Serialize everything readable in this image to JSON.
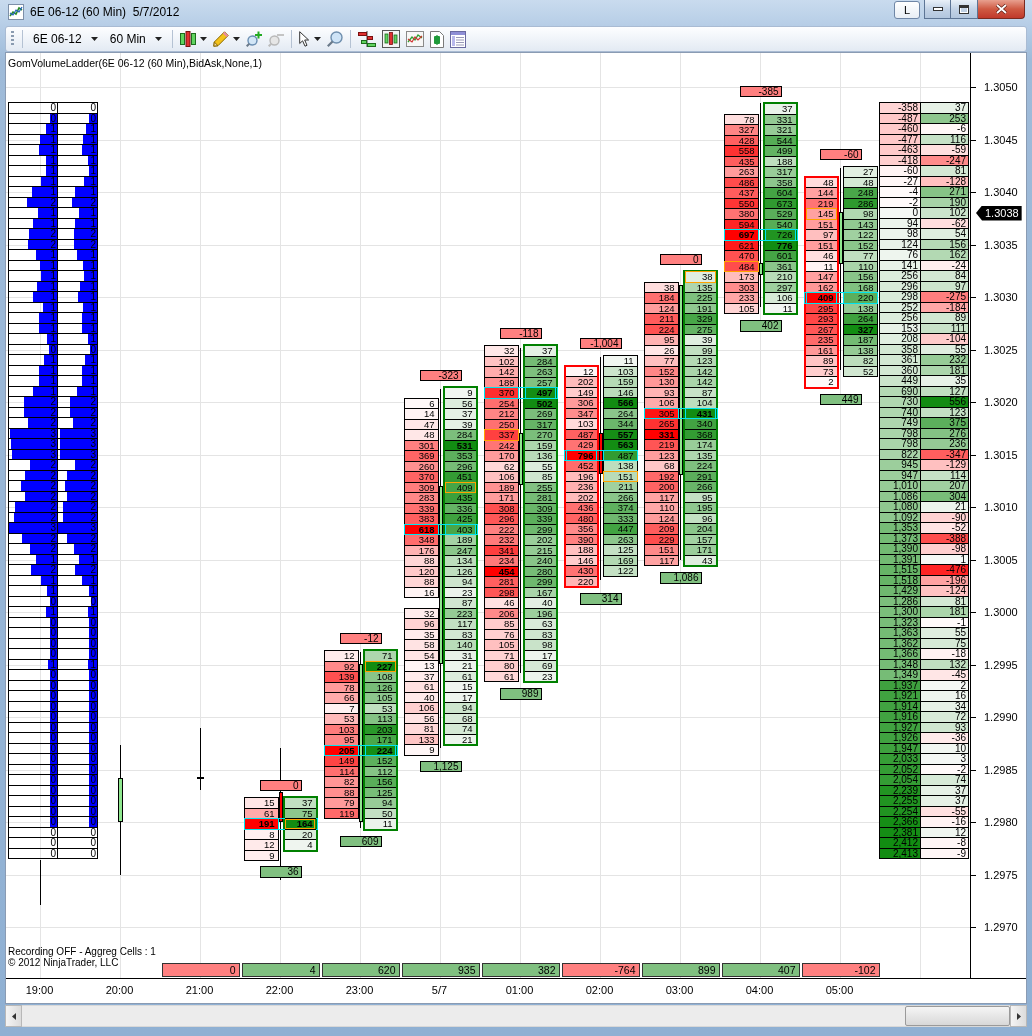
{
  "window": {
    "title": "6E 06-12 (60 Min)  5/7/2012",
    "title_button": "L"
  },
  "toolbar": {
    "instrument": "6E 06-12",
    "period": "60 Min",
    "zoom_out_disabled": true
  },
  "indicator_label": "GomVolumeLadder(6E 06-12 (60 Min),BidAsk,None,1)",
  "ladder": {
    "columns": [
      {
        "cells": [
          {
            "value": "0"
          },
          {
            "value": "0",
            "level": 0.15
          },
          {
            "value": "1",
            "level": 0.23
          },
          {
            "value": "1",
            "level": 0.35
          },
          {
            "value": "1",
            "level": 0.37
          },
          {
            "value": "1",
            "level": 0.23
          },
          {
            "value": "1",
            "level": 0.22
          },
          {
            "value": "1",
            "level": 0.33
          },
          {
            "value": "1",
            "level": 0.53
          },
          {
            "value": "2",
            "level": 0.63
          },
          {
            "value": "1",
            "level": 0.4
          },
          {
            "value": "1",
            "level": 0.51
          },
          {
            "value": "2",
            "level": 0.59
          },
          {
            "value": "2",
            "level": 0.6
          },
          {
            "value": "1",
            "level": 0.43
          },
          {
            "value": "1",
            "level": 0.35
          },
          {
            "value": "1",
            "level": 0.33
          },
          {
            "value": "1",
            "level": 0.41
          },
          {
            "value": "1",
            "level": 0.49
          },
          {
            "value": "1",
            "level": 0.3
          },
          {
            "value": "1",
            "level": 0.37
          },
          {
            "value": "1",
            "level": 0.37
          },
          {
            "value": "1",
            "level": 0.2
          },
          {
            "value": "0",
            "level": 0.17
          },
          {
            "value": "1",
            "level": 0.27
          },
          {
            "value": "1",
            "level": 0.37
          },
          {
            "value": "1",
            "level": 0.38
          },
          {
            "value": "1",
            "level": 0.49
          },
          {
            "value": "2",
            "level": 0.69
          },
          {
            "value": "2",
            "level": 0.69
          },
          {
            "value": "2",
            "level": 0.6
          },
          {
            "value": "3",
            "level": 0.97
          },
          {
            "value": "3",
            "level": 0.95
          },
          {
            "value": "3",
            "level": 0.93
          },
          {
            "value": "2",
            "level": 0.57
          },
          {
            "value": "2",
            "level": 0.67
          },
          {
            "value": "2",
            "level": 0.75
          },
          {
            "value": "2",
            "level": 0.67
          },
          {
            "value": "2",
            "level": 0.87
          },
          {
            "value": "2",
            "level": 0.89
          },
          {
            "value": "3",
            "level": 1
          },
          {
            "value": "2",
            "level": 0.73
          },
          {
            "value": "2",
            "level": 0.57
          },
          {
            "value": "1",
            "level": 0.43
          },
          {
            "value": "2",
            "level": 0.55
          },
          {
            "value": "1",
            "level": 0.33
          },
          {
            "value": "1",
            "level": 0.2
          },
          {
            "value": "0",
            "level": 0.15
          },
          {
            "value": "1",
            "level": 0.23
          },
          {
            "value": "0",
            "level": 0.15
          },
          {
            "value": "0",
            "level": 0.15
          },
          {
            "value": "0",
            "level": 0.15
          },
          {
            "value": "0",
            "level": 0.15
          },
          {
            "value": "1",
            "level": 0.19
          },
          {
            "value": "0",
            "level": 0.15
          },
          {
            "value": "0",
            "level": 0.15
          },
          {
            "value": "0",
            "level": 0.15
          },
          {
            "value": "0",
            "level": 0.15
          },
          {
            "value": "0",
            "level": 0.15
          },
          {
            "value": "0",
            "level": 0.15
          },
          {
            "value": "0",
            "level": 0.15
          },
          {
            "value": "0",
            "level": 0.15
          },
          {
            "value": "0",
            "level": 0.15
          },
          {
            "value": "0",
            "level": 0.15
          },
          {
            "value": "0",
            "level": 0.15
          },
          {
            "value": "0",
            "level": 0.15
          },
          {
            "value": "0",
            "level": 0.15
          },
          {
            "value": "0",
            "level": 0.15
          },
          {
            "value": "0",
            "level": 0.15
          },
          {
            "value": "0"
          },
          {
            "value": "0"
          },
          {
            "value": "0"
          }
        ]
      },
      {
        "cells": [
          {
            "value": "0"
          },
          {
            "value": "0",
            "level": 0.2
          },
          {
            "value": "1",
            "level": 0.27
          },
          {
            "value": "1",
            "level": 0.37
          },
          {
            "value": "1",
            "level": 0.39
          },
          {
            "value": "1",
            "level": 0.23
          },
          {
            "value": "1",
            "level": 0.21
          },
          {
            "value": "1",
            "level": 0.33
          },
          {
            "value": "1",
            "level": 0.57
          },
          {
            "value": "2",
            "level": 0.63
          },
          {
            "value": "1",
            "level": 0.45
          },
          {
            "value": "1",
            "level": 0.57
          },
          {
            "value": "2",
            "level": 0.6
          },
          {
            "value": "2",
            "level": 0.6
          },
          {
            "value": "1",
            "level": 0.51
          },
          {
            "value": "1",
            "level": 0.37
          },
          {
            "value": "1",
            "level": 0.33
          },
          {
            "value": "1",
            "level": 0.43
          },
          {
            "value": "1",
            "level": 0.49
          },
          {
            "value": "1",
            "level": 0.35
          },
          {
            "value": "1",
            "level": 0.39
          },
          {
            "value": "1",
            "level": 0.39
          },
          {
            "value": "1",
            "level": 0.23
          },
          {
            "value": "0",
            "level": 0.18
          },
          {
            "value": "1",
            "level": 0.3
          },
          {
            "value": "1",
            "level": 0.39
          },
          {
            "value": "1",
            "level": 0.39
          },
          {
            "value": "1",
            "level": 0.51
          },
          {
            "value": "2",
            "level": 0.7
          },
          {
            "value": "2",
            "level": 0.7
          },
          {
            "value": "2",
            "level": 0.61
          },
          {
            "value": "3",
            "level": 0.96
          },
          {
            "value": "3",
            "level": 0.94
          },
          {
            "value": "3",
            "level": 0.94
          },
          {
            "value": "2",
            "level": 0.57
          },
          {
            "value": "2",
            "level": 0.76
          },
          {
            "value": "2",
            "level": 0.82
          },
          {
            "value": "2",
            "level": 0.76
          },
          {
            "value": "2",
            "level": 0.88
          },
          {
            "value": "2",
            "level": 0.88
          },
          {
            "value": "3",
            "level": 1
          },
          {
            "value": "2",
            "level": 0.76
          },
          {
            "value": "2",
            "level": 0.6
          },
          {
            "value": "1",
            "level": 0.45
          },
          {
            "value": "2",
            "level": 0.57
          },
          {
            "value": "1",
            "level": 0.39
          },
          {
            "value": "1",
            "level": 0.21
          },
          {
            "value": "0",
            "level": 0.15
          },
          {
            "value": "1",
            "level": 0.23
          },
          {
            "value": "0",
            "level": 0.2
          },
          {
            "value": "0",
            "level": 0.2
          },
          {
            "value": "0",
            "level": 0.2
          },
          {
            "value": "0",
            "level": 0.2
          },
          {
            "value": "1",
            "level": 0.23
          },
          {
            "value": "0",
            "level": 0.2
          },
          {
            "value": "0",
            "level": 0.2
          },
          {
            "value": "0",
            "level": 0.2
          },
          {
            "value": "0",
            "level": 0.2
          },
          {
            "value": "0",
            "level": 0.2
          },
          {
            "value": "0",
            "level": 0.2
          },
          {
            "value": "0",
            "level": 0.2
          },
          {
            "value": "0",
            "level": 0.2
          },
          {
            "value": "0",
            "level": 0.2
          },
          {
            "value": "0",
            "level": 0.2
          },
          {
            "value": "0",
            "level": 0.2
          },
          {
            "value": "0",
            "level": 0.2
          },
          {
            "value": "0",
            "level": 0.2
          },
          {
            "value": "0",
            "level": 0.2
          },
          {
            "value": "0",
            "level": 0.2
          },
          {
            "value": "0"
          },
          {
            "value": "0"
          },
          {
            "value": "0"
          }
        ]
      }
    ]
  },
  "candles": [
    {
      "kind": "wick_only"
    },
    {
      "kind": "up"
    },
    {
      "kind": "doji"
    },
    {
      "kind": "down"
    },
    {
      "kind": "up"
    },
    {
      "kind": "up"
    },
    {
      "kind": "up"
    },
    {
      "kind": "down"
    },
    {
      "kind": "up"
    },
    {
      "kind": "up"
    },
    {
      "kind": "up"
    }
  ],
  "bars": [
    {
      "top_label": "0",
      "bottom_label": "36",
      "bid_framed": false,
      "ask_framed": true,
      "rows": [
        {
          "bid": "15",
          "ask": "37",
          "highlighted": false,
          "kind": "plain"
        },
        {
          "bid": "61",
          "ask": "75",
          "highlighted": false,
          "kind": "plain"
        },
        {
          "bid": "191",
          "ask": "164",
          "highlighted": true,
          "kind": "ask_marked"
        },
        {
          "bid": "8",
          "ask": "20",
          "highlighted": false,
          "kind": "plain"
        },
        {
          "bid": "12",
          "ask": "4",
          "highlighted": false,
          "kind": "plain"
        },
        {
          "bid": "9",
          "highlighted": false,
          "kind": "plain"
        }
      ]
    },
    {
      "top_label": "-12",
      "bottom_label": "609",
      "bid_framed": false,
      "ask_framed": true,
      "rows": [
        {
          "bid": "12",
          "ask": "71",
          "highlighted": false,
          "kind": "plain"
        },
        {
          "bid": "92",
          "ask": "227",
          "highlighted": false,
          "kind": "ask_marked"
        },
        {
          "bid": "139",
          "ask": "108",
          "highlighted": false,
          "kind": "plain"
        },
        {
          "bid": "78",
          "ask": "126",
          "highlighted": false,
          "kind": "plain"
        },
        {
          "bid": "66",
          "ask": "105",
          "highlighted": false,
          "kind": "plain"
        },
        {
          "bid": "7",
          "ask": "53",
          "highlighted": false,
          "kind": "plain"
        },
        {
          "bid": "53",
          "ask": "113",
          "highlighted": false,
          "kind": "plain"
        },
        {
          "bid": "103",
          "ask": "203",
          "highlighted": false,
          "kind": "plain"
        },
        {
          "bid": "95",
          "ask": "171",
          "highlighted": false,
          "kind": "plain"
        },
        {
          "bid": "205",
          "ask": "224",
          "highlighted": true,
          "kind": "plain"
        },
        {
          "bid": "149",
          "ask": "152",
          "highlighted": false,
          "kind": "plain"
        },
        {
          "bid": "114",
          "ask": "112",
          "highlighted": false,
          "kind": "plain"
        },
        {
          "bid": "82",
          "ask": "156",
          "highlighted": false,
          "kind": "plain"
        },
        {
          "bid": "88",
          "ask": "125",
          "highlighted": false,
          "kind": "plain"
        },
        {
          "bid": "79",
          "ask": "94",
          "highlighted": false,
          "kind": "plain"
        },
        {
          "bid": "119",
          "ask": "50",
          "highlighted": false,
          "kind": "plain"
        },
        {
          "ask": "11",
          "highlighted": false,
          "kind": "plain"
        }
      ]
    },
    {
      "top_label": "-323",
      "bottom_label": "1,125",
      "bid_framed": false,
      "ask_framed": true,
      "rows": [
        {
          "ask": "9",
          "highlighted": false,
          "kind": "plain"
        },
        {
          "bid": "6",
          "ask": "56",
          "highlighted": false,
          "kind": "plain"
        },
        {
          "bid": "14",
          "ask": "37",
          "highlighted": false,
          "kind": "plain"
        },
        {
          "bid": "47",
          "ask": "39",
          "highlighted": false,
          "kind": "plain"
        },
        {
          "bid": "48",
          "ask": "284",
          "highlighted": false,
          "kind": "plain"
        },
        {
          "bid": "301",
          "ask": "531",
          "highlighted": false,
          "kind": "plain"
        },
        {
          "bid": "369",
          "ask": "353",
          "highlighted": false,
          "kind": "plain"
        },
        {
          "bid": "260",
          "ask": "296",
          "highlighted": false,
          "kind": "plain"
        },
        {
          "bid": "370",
          "ask": "451",
          "highlighted": false,
          "kind": "plain"
        },
        {
          "bid": "309",
          "ask": "409",
          "highlighted": false,
          "kind": "ask_marked"
        },
        {
          "bid": "283",
          "ask": "435",
          "highlighted": false,
          "kind": "plain"
        },
        {
          "bid": "339",
          "ask": "336",
          "highlighted": false,
          "kind": "plain"
        },
        {
          "bid": "383",
          "ask": "425",
          "highlighted": false,
          "kind": "plain"
        },
        {
          "bid": "618",
          "ask": "403",
          "highlighted": true,
          "kind": "plain"
        },
        {
          "bid": "348",
          "ask": "189",
          "highlighted": false,
          "kind": "plain"
        },
        {
          "bid": "176",
          "ask": "247",
          "highlighted": false,
          "kind": "plain"
        },
        {
          "bid": "88",
          "ask": "134",
          "highlighted": false,
          "kind": "plain"
        },
        {
          "bid": "120",
          "ask": "126",
          "highlighted": false,
          "kind": "plain"
        },
        {
          "bid": "88",
          "ask": "94",
          "highlighted": false,
          "kind": "plain"
        },
        {
          "bid": "16",
          "ask": "23",
          "highlighted": false,
          "kind": "plain"
        },
        {
          "ask": "87",
          "highlighted": false,
          "kind": "plain"
        },
        {
          "bid": "32",
          "ask": "223",
          "highlighted": false,
          "kind": "plain"
        },
        {
          "bid": "96",
          "ask": "117",
          "highlighted": false,
          "kind": "plain"
        },
        {
          "bid": "35",
          "ask": "83",
          "highlighted": false,
          "kind": "plain"
        },
        {
          "bid": "58",
          "ask": "140",
          "highlighted": false,
          "kind": "plain"
        },
        {
          "bid": "54",
          "ask": "31",
          "highlighted": false,
          "kind": "plain"
        },
        {
          "bid": "13",
          "ask": "21",
          "highlighted": false,
          "kind": "plain"
        },
        {
          "bid": "37",
          "ask": "61",
          "highlighted": false,
          "kind": "plain"
        },
        {
          "bid": "61",
          "ask": "15",
          "highlighted": false,
          "kind": "plain"
        },
        {
          "bid": "40",
          "ask": "17",
          "highlighted": false,
          "kind": "plain"
        },
        {
          "bid": "106",
          "ask": "94",
          "highlighted": false,
          "kind": "plain"
        },
        {
          "bid": "56",
          "ask": "68",
          "highlighted": false,
          "kind": "plain"
        },
        {
          "bid": "81",
          "ask": "74",
          "highlighted": false,
          "kind": "plain"
        },
        {
          "bid": "133",
          "ask": "21",
          "highlighted": false,
          "kind": "plain"
        },
        {
          "bid": "9",
          "highlighted": false,
          "kind": "plain"
        }
      ]
    },
    {
      "top_label": "-118",
      "bottom_label": "989",
      "bid_framed": false,
      "ask_framed": true,
      "rows": [
        {
          "bid": "32",
          "ask": "37",
          "highlighted": false,
          "kind": "plain"
        },
        {
          "bid": "102",
          "ask": "284",
          "highlighted": false,
          "kind": "plain"
        },
        {
          "bid": "142",
          "ask": "263",
          "highlighted": false,
          "kind": "plain"
        },
        {
          "bid": "189",
          "ask": "257",
          "highlighted": false,
          "kind": "plain"
        },
        {
          "bid": "370",
          "ask": "497",
          "highlighted": true,
          "kind": "plain"
        },
        {
          "bid": "254",
          "ask": "502",
          "highlighted": false,
          "kind": "plain"
        },
        {
          "bid": "212",
          "ask": "269",
          "highlighted": false,
          "kind": "plain"
        },
        {
          "bid": "250",
          "ask": "317",
          "highlighted": false,
          "kind": "plain"
        },
        {
          "bid": "337",
          "ask": "270",
          "highlighted": false,
          "kind": "bid_marked"
        },
        {
          "bid": "242",
          "ask": "159",
          "highlighted": false,
          "kind": "plain"
        },
        {
          "bid": "170",
          "ask": "136",
          "highlighted": false,
          "kind": "plain"
        },
        {
          "bid": "62",
          "ask": "55",
          "highlighted": false,
          "kind": "plain"
        },
        {
          "bid": "106",
          "ask": "85",
          "highlighted": false,
          "kind": "plain"
        },
        {
          "bid": "189",
          "ask": "255",
          "highlighted": false,
          "kind": "plain"
        },
        {
          "bid": "171",
          "ask": "281",
          "highlighted": false,
          "kind": "plain"
        },
        {
          "bid": "308",
          "ask": "309",
          "highlighted": false,
          "kind": "plain"
        },
        {
          "bid": "296",
          "ask": "339",
          "highlighted": false,
          "kind": "plain"
        },
        {
          "bid": "222",
          "ask": "299",
          "highlighted": false,
          "kind": "plain"
        },
        {
          "bid": "232",
          "ask": "202",
          "highlighted": false,
          "kind": "plain"
        },
        {
          "bid": "341",
          "ask": "215",
          "highlighted": false,
          "kind": "plain"
        },
        {
          "bid": "234",
          "ask": "240",
          "highlighted": false,
          "kind": "plain"
        },
        {
          "bid": "454",
          "ask": "280",
          "highlighted": false,
          "kind": "plain"
        },
        {
          "bid": "281",
          "ask": "299",
          "highlighted": false,
          "kind": "plain"
        },
        {
          "bid": "298",
          "ask": "167",
          "highlighted": false,
          "kind": "plain"
        },
        {
          "bid": "46",
          "ask": "40",
          "highlighted": false,
          "kind": "plain"
        },
        {
          "bid": "206",
          "ask": "196",
          "highlighted": false,
          "kind": "plain"
        },
        {
          "bid": "85",
          "ask": "63",
          "highlighted": false,
          "kind": "plain"
        },
        {
          "bid": "76",
          "ask": "83",
          "highlighted": false,
          "kind": "plain"
        },
        {
          "bid": "105",
          "ask": "98",
          "highlighted": false,
          "kind": "plain"
        },
        {
          "bid": "71",
          "ask": "17",
          "highlighted": false,
          "kind": "plain"
        },
        {
          "bid": "80",
          "ask": "69",
          "highlighted": false,
          "kind": "plain"
        },
        {
          "bid": "61",
          "ask": "23",
          "highlighted": false,
          "kind": "plain"
        }
      ]
    },
    {
      "top_label": "-1,004",
      "bottom_label": "314",
      "bid_framed": true,
      "ask_framed": false,
      "rows": [
        {
          "ask": "11",
          "highlighted": false,
          "kind": "plain"
        },
        {
          "bid": "12",
          "ask": "103",
          "highlighted": false,
          "kind": "plain"
        },
        {
          "bid": "202",
          "ask": "159",
          "highlighted": false,
          "kind": "plain"
        },
        {
          "bid": "149",
          "ask": "146",
          "highlighted": false,
          "kind": "plain"
        },
        {
          "bid": "306",
          "ask": "566",
          "highlighted": false,
          "kind": "plain"
        },
        {
          "bid": "347",
          "ask": "264",
          "highlighted": false,
          "kind": "plain"
        },
        {
          "bid": "103",
          "ask": "344",
          "highlighted": false,
          "kind": "plain"
        },
        {
          "bid": "487",
          "ask": "557",
          "highlighted": false,
          "kind": "plain"
        },
        {
          "bid": "429",
          "ask": "563",
          "highlighted": false,
          "kind": "plain"
        },
        {
          "bid": "796",
          "ask": "487",
          "highlighted": true,
          "kind": "plain"
        },
        {
          "bid": "452",
          "ask": "138",
          "highlighted": false,
          "kind": "plain"
        },
        {
          "bid": "196",
          "ask": "151",
          "highlighted": false,
          "kind": "ask_marked"
        },
        {
          "bid": "236",
          "ask": "211",
          "highlighted": false,
          "kind": "plain"
        },
        {
          "bid": "202",
          "ask": "266",
          "highlighted": false,
          "kind": "plain"
        },
        {
          "bid": "436",
          "ask": "374",
          "highlighted": false,
          "kind": "plain"
        },
        {
          "bid": "480",
          "ask": "333",
          "highlighted": false,
          "kind": "plain"
        },
        {
          "bid": "356",
          "ask": "447",
          "highlighted": false,
          "kind": "plain"
        },
        {
          "bid": "390",
          "ask": "263",
          "highlighted": false,
          "kind": "plain"
        },
        {
          "bid": "188",
          "ask": "125",
          "highlighted": false,
          "kind": "plain"
        },
        {
          "bid": "146",
          "ask": "169",
          "highlighted": false,
          "kind": "plain"
        },
        {
          "bid": "430",
          "ask": "122",
          "highlighted": false,
          "kind": "plain"
        },
        {
          "bid": "220",
          "highlighted": false,
          "kind": "plain"
        }
      ]
    },
    {
      "top_label": "0",
      "bottom_label": "1,086",
      "bid_framed": false,
      "ask_framed": true,
      "rows": [
        {
          "ask": "38",
          "highlighted": false,
          "kind": "ask_marked"
        },
        {
          "bid": "38",
          "ask": "135",
          "highlighted": false,
          "kind": "plain"
        },
        {
          "bid": "184",
          "ask": "225",
          "highlighted": false,
          "kind": "plain"
        },
        {
          "bid": "124",
          "ask": "191",
          "highlighted": false,
          "kind": "plain"
        },
        {
          "bid": "211",
          "ask": "329",
          "highlighted": false,
          "kind": "plain"
        },
        {
          "bid": "224",
          "ask": "275",
          "highlighted": false,
          "kind": "plain"
        },
        {
          "bid": "95",
          "ask": "39",
          "highlighted": false,
          "kind": "plain"
        },
        {
          "bid": "26",
          "ask": "99",
          "highlighted": false,
          "kind": "plain"
        },
        {
          "bid": "77",
          "ask": "123",
          "highlighted": false,
          "kind": "plain"
        },
        {
          "bid": "152",
          "ask": "142",
          "highlighted": false,
          "kind": "plain"
        },
        {
          "bid": "130",
          "ask": "142",
          "highlighted": false,
          "kind": "plain"
        },
        {
          "bid": "93",
          "ask": "87",
          "highlighted": false,
          "kind": "plain"
        },
        {
          "bid": "106",
          "ask": "104",
          "highlighted": false,
          "kind": "plain"
        },
        {
          "bid": "305",
          "ask": "431",
          "highlighted": true,
          "kind": "plain"
        },
        {
          "bid": "265",
          "ask": "340",
          "highlighted": false,
          "kind": "plain"
        },
        {
          "bid": "331",
          "ask": "368",
          "highlighted": false,
          "kind": "plain"
        },
        {
          "bid": "219",
          "ask": "174",
          "highlighted": false,
          "kind": "plain"
        },
        {
          "bid": "123",
          "ask": "135",
          "highlighted": false,
          "kind": "plain"
        },
        {
          "bid": "68",
          "ask": "224",
          "highlighted": false,
          "kind": "plain"
        },
        {
          "bid": "192",
          "ask": "291",
          "highlighted": false,
          "kind": "plain"
        },
        {
          "bid": "200",
          "ask": "266",
          "highlighted": false,
          "kind": "plain"
        },
        {
          "bid": "117",
          "ask": "95",
          "highlighted": false,
          "kind": "plain"
        },
        {
          "bid": "110",
          "ask": "195",
          "highlighted": false,
          "kind": "plain"
        },
        {
          "bid": "124",
          "ask": "96",
          "highlighted": false,
          "kind": "plain"
        },
        {
          "bid": "209",
          "ask": "204",
          "highlighted": false,
          "kind": "plain"
        },
        {
          "bid": "229",
          "ask": "157",
          "highlighted": false,
          "kind": "plain"
        },
        {
          "bid": "151",
          "ask": "171",
          "highlighted": false,
          "kind": "plain"
        },
        {
          "bid": "117",
          "ask": "43",
          "highlighted": false,
          "kind": "plain"
        }
      ]
    },
    {
      "top_label": "-385",
      "bottom_label": "402",
      "bid_framed": false,
      "ask_framed": true,
      "rows": [
        {
          "ask": "37",
          "highlighted": false,
          "kind": "plain"
        },
        {
          "bid": "78",
          "ask": "331",
          "highlighted": false,
          "kind": "plain"
        },
        {
          "bid": "327",
          "ask": "321",
          "highlighted": false,
          "kind": "plain"
        },
        {
          "bid": "428",
          "ask": "544",
          "highlighted": false,
          "kind": "plain"
        },
        {
          "bid": "558",
          "ask": "499",
          "highlighted": false,
          "kind": "plain"
        },
        {
          "bid": "435",
          "ask": "188",
          "highlighted": false,
          "kind": "plain"
        },
        {
          "bid": "263",
          "ask": "317",
          "highlighted": false,
          "kind": "plain"
        },
        {
          "bid": "486",
          "ask": "358",
          "highlighted": false,
          "kind": "plain"
        },
        {
          "bid": "437",
          "ask": "604",
          "highlighted": false,
          "kind": "plain"
        },
        {
          "bid": "550",
          "ask": "673",
          "highlighted": false,
          "kind": "plain"
        },
        {
          "bid": "380",
          "ask": "529",
          "highlighted": false,
          "kind": "plain"
        },
        {
          "bid": "594",
          "ask": "540",
          "highlighted": false,
          "kind": "plain"
        },
        {
          "bid": "697",
          "ask": "726",
          "highlighted": true,
          "kind": "plain"
        },
        {
          "bid": "621",
          "ask": "776",
          "highlighted": false,
          "kind": "plain"
        },
        {
          "bid": "470",
          "ask": "601",
          "highlighted": false,
          "kind": "plain"
        },
        {
          "bid": "484",
          "ask": "361",
          "highlighted": false,
          "kind": "bid_marked"
        },
        {
          "bid": "173",
          "ask": "210",
          "highlighted": false,
          "kind": "plain"
        },
        {
          "bid": "303",
          "ask": "297",
          "highlighted": false,
          "kind": "plain"
        },
        {
          "bid": "233",
          "ask": "106",
          "highlighted": false,
          "kind": "plain"
        },
        {
          "bid": "105",
          "ask": "11",
          "highlighted": false,
          "kind": "plain"
        }
      ]
    },
    {
      "top_label": "-60",
      "bottom_label": "449",
      "bid_framed": true,
      "ask_framed": false,
      "rows": [
        {
          "ask": "27",
          "highlighted": false,
          "kind": "plain"
        },
        {
          "bid": "48",
          "ask": "48",
          "highlighted": false,
          "kind": "plain"
        },
        {
          "bid": "144",
          "ask": "248",
          "highlighted": false,
          "kind": "plain"
        },
        {
          "bid": "219",
          "ask": "286",
          "highlighted": false,
          "kind": "plain"
        },
        {
          "bid": "145",
          "ask": "98",
          "highlighted": false,
          "kind": "bid_marked"
        },
        {
          "bid": "151",
          "ask": "143",
          "highlighted": false,
          "kind": "plain"
        },
        {
          "bid": "97",
          "ask": "122",
          "highlighted": false,
          "kind": "plain"
        },
        {
          "bid": "151",
          "ask": "152",
          "highlighted": false,
          "kind": "plain"
        },
        {
          "bid": "46",
          "ask": "77",
          "highlighted": false,
          "kind": "plain"
        },
        {
          "bid": "11",
          "ask": "110",
          "highlighted": false,
          "kind": "plain"
        },
        {
          "bid": "147",
          "ask": "156",
          "highlighted": false,
          "kind": "plain"
        },
        {
          "bid": "162",
          "ask": "168",
          "highlighted": false,
          "kind": "plain"
        },
        {
          "bid": "409",
          "ask": "220",
          "highlighted": true,
          "kind": "plain"
        },
        {
          "bid": "295",
          "ask": "138",
          "highlighted": false,
          "kind": "plain"
        },
        {
          "bid": "293",
          "ask": "264",
          "highlighted": false,
          "kind": "plain"
        },
        {
          "bid": "267",
          "ask": "327",
          "highlighted": false,
          "kind": "plain"
        },
        {
          "bid": "235",
          "ask": "187",
          "highlighted": false,
          "kind": "plain"
        },
        {
          "bid": "161",
          "ask": "138",
          "highlighted": false,
          "kind": "plain"
        },
        {
          "bid": "89",
          "ask": "82",
          "highlighted": false,
          "kind": "plain"
        },
        {
          "bid": "73",
          "ask": "52",
          "highlighted": false,
          "kind": "plain"
        },
        {
          "bid": "2",
          "highlighted": false,
          "kind": "plain"
        }
      ]
    }
  ],
  "profile": {
    "columns": [
      {
        "cells": [
          "-358",
          "-487",
          "-460",
          "-477",
          "-463",
          "-418",
          "-60",
          "-27",
          "-4",
          "-2",
          "0",
          "94",
          "98",
          "124",
          "76",
          "141",
          "256",
          "296",
          "298",
          "252",
          "256",
          "153",
          "208",
          "358",
          "361",
          "360",
          "449",
          "690",
          "730",
          "740",
          "749",
          "798",
          "798",
          "822",
          "945",
          "947",
          "1,010",
          "1,086",
          "1,080",
          "1,092",
          "1,353",
          "1,373",
          "1,390",
          "1,391",
          "1,515",
          "1,518",
          "1,429",
          "1,286",
          "1,300",
          "1,323",
          "1,363",
          "1,362",
          "1,366",
          "1,348",
          "1,349",
          "1,937",
          "1,921",
          "1,914",
          "1,916",
          "1,927",
          "1,926",
          "1,947",
          "2,033",
          "2,052",
          "2,054",
          "2,239",
          "2,255",
          "2,254",
          "2,366",
          "2,381",
          "2,412",
          "2,413"
        ]
      },
      {
        "cells": [
          "37",
          "253",
          "-6",
          "116",
          "-59",
          "-247",
          "81",
          "-128",
          "271",
          "190",
          "102",
          "-62",
          "54",
          "156",
          "162",
          "-24",
          "84",
          "97",
          "-275",
          "-184",
          "89",
          "111",
          "-104",
          "55",
          "232",
          "181",
          "35",
          "127",
          "556",
          "123",
          "375",
          "276",
          "236",
          "-347",
          "-129",
          "114",
          "207",
          "304",
          "21",
          "-90",
          "-52",
          "-388",
          "-98",
          "1",
          "-476",
          "-196",
          "-124",
          "81",
          "181",
          "-1",
          "55",
          "75",
          "-18",
          "132",
          "-45",
          "2",
          "16",
          "34",
          "72",
          "93",
          "-36",
          "10",
          "3",
          "-2",
          "74",
          "37",
          "37",
          "-55",
          "-16",
          "12",
          "-8",
          "-9"
        ]
      }
    ]
  },
  "status_lines": [
    "Recording OFF - Aggreg Cells : 1",
    "© 2012 NinjaTrader, LLC"
  ],
  "footer_values": [
    "0",
    "4",
    "620",
    "935",
    "382",
    "-764",
    "899",
    "407",
    "-102"
  ],
  "price_axis": {
    "labels": [
      "1.3050",
      "1.3045",
      "1.3040",
      "1.3035",
      "1.3030",
      "1.3025",
      "1.3020",
      "1.3015",
      "1.3010",
      "1.3005",
      "1.3000",
      "1.2995",
      "1.2990",
      "1.2985",
      "1.2980",
      "1.2975",
      "1.2970"
    ],
    "current_price": "1.3038"
  },
  "time_axis": {
    "labels": [
      "19:00",
      "20:00",
      "21:00",
      "22:00",
      "23:00",
      "5/7",
      "01:00",
      "02:00",
      "03:00",
      "04:00",
      "05:00"
    ]
  }
}
